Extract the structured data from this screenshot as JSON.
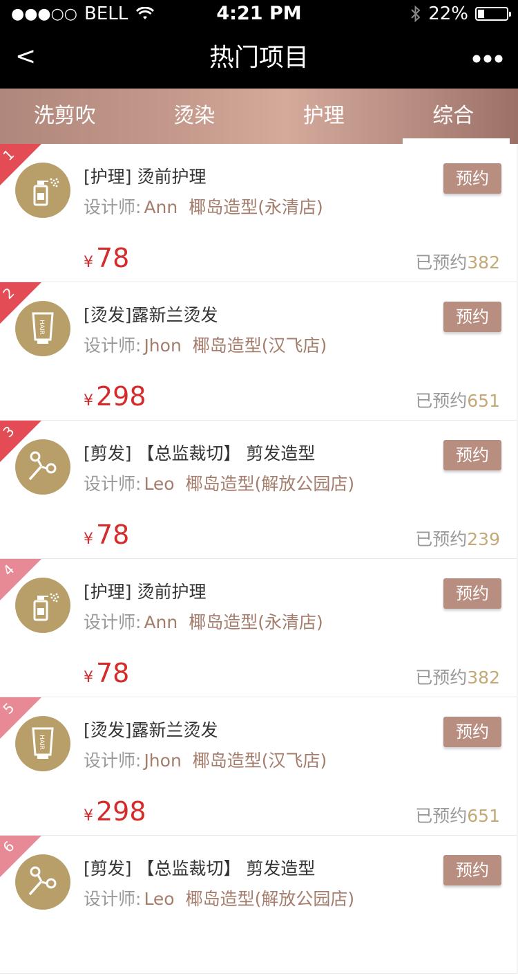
{
  "status_bar": {
    "signal": "●●●○○",
    "carrier": "BELL",
    "time": "4:21 PM",
    "battery": "22%",
    "battery_level": 0.22
  },
  "nav": {
    "back_label": "<",
    "title": "热门项目",
    "more_label": "●●●"
  },
  "tabs": [
    {
      "label": "洗剪吹",
      "active": false
    },
    {
      "label": "烫染",
      "active": false
    },
    {
      "label": "护理",
      "active": false
    },
    {
      "label": "综合",
      "active": true
    }
  ],
  "designer_prefix": "设计师:",
  "booked_prefix": "已预约",
  "currency": "¥",
  "book_label": "预约",
  "items": [
    {
      "rank": "1",
      "icon": "spray-bottle-icon",
      "title": "[护理] 烫前护理",
      "designer": "Ann",
      "shop": "椰岛造型(永清店)",
      "price": "78",
      "booked": "382"
    },
    {
      "rank": "2",
      "icon": "cream-tube-icon",
      "title": "[烫发]露新兰烫发",
      "designer": "Jhon",
      "shop": "椰岛造型(汉飞店)",
      "price": "298",
      "booked": "651"
    },
    {
      "rank": "3",
      "icon": "scissors-icon",
      "title": "[剪发] 【总监裁切】 剪发造型",
      "designer": "Leo",
      "shop": "椰岛造型(解放公园店)",
      "price": "78",
      "booked": "239"
    },
    {
      "rank": "4",
      "icon": "spray-bottle-icon",
      "title": "[护理] 烫前护理",
      "designer": "Ann",
      "shop": "椰岛造型(永清店)",
      "price": "78",
      "booked": "382"
    },
    {
      "rank": "5",
      "icon": "cream-tube-icon",
      "title": "[烫发]露新兰烫发",
      "designer": "Jhon",
      "shop": "椰岛造型(汉飞店)",
      "price": "298",
      "booked": "651"
    },
    {
      "rank": "6",
      "icon": "scissors-icon",
      "title": "[剪发] 【总监裁切】 剪发造型",
      "designer": "Leo",
      "shop": "椰岛造型(解放公园店)",
      "price": "",
      "booked": ""
    }
  ],
  "colors": {
    "rank_top": "#e34c55",
    "rank_low": "#e88a96",
    "accent_button": "#b88e81",
    "price": "#d52b2b",
    "avatar_bg": "#b89f6a"
  }
}
